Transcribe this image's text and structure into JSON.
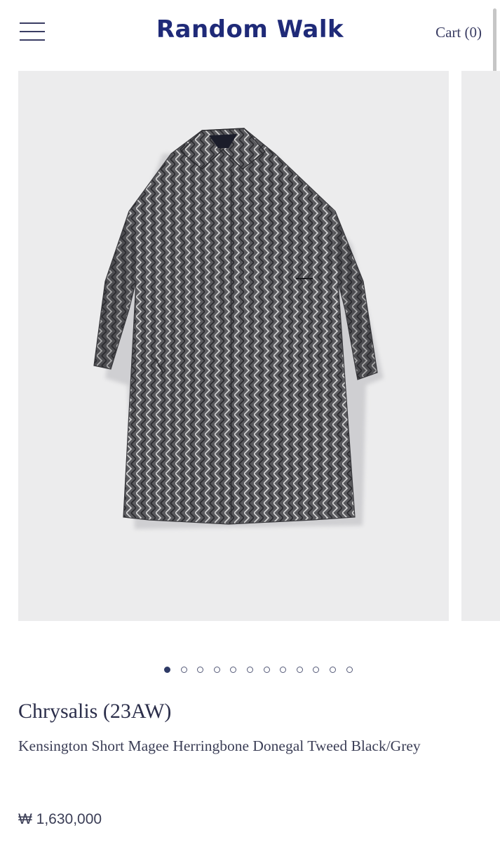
{
  "header": {
    "menu_icon": "hamburger-menu-icon",
    "logo": "Random Walk",
    "cart_label": "Cart (0)"
  },
  "gallery": {
    "image_description": "product-photo-herringbone-tweed-coat",
    "slide_count": 12,
    "active_slide": 1,
    "background_color": "#ececed"
  },
  "product": {
    "brand": "Chrysalis (23AW)",
    "name": "Kensington Short Magee Herringbone Donegal Tweed Black/Grey",
    "price": "₩ 1,630,000"
  },
  "colors": {
    "logo": "#1f2a78",
    "text": "#2b2e4a",
    "dot_active": "#2e3a66"
  }
}
